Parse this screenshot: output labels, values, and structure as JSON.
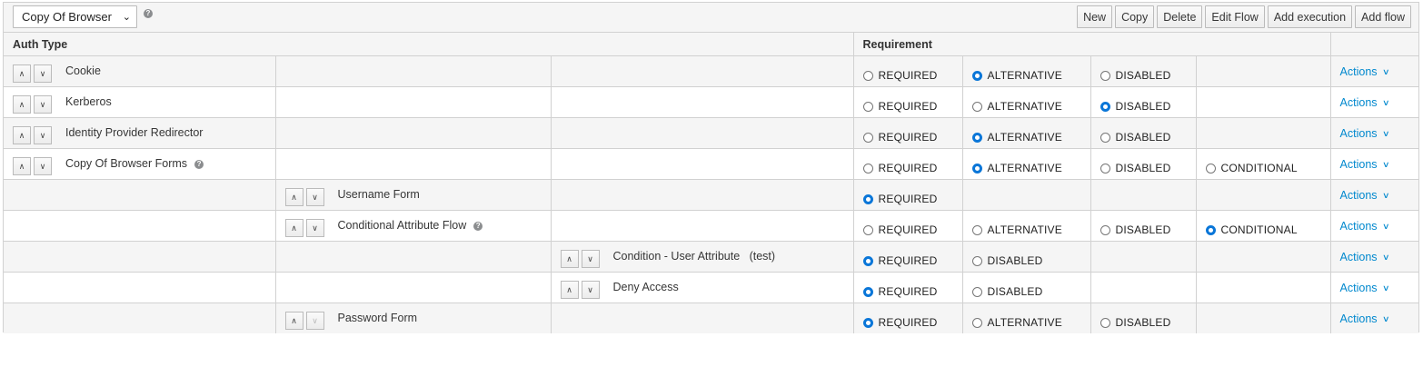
{
  "toolbar": {
    "flow_select": "Copy Of Browser",
    "buttons": [
      "New",
      "Copy",
      "Delete",
      "Edit Flow",
      "Add execution",
      "Add flow"
    ]
  },
  "table": {
    "headers": {
      "auth_type": "Auth Type",
      "requirement": "Requirement"
    },
    "rows": [
      {
        "name": "Cookie",
        "level": 0,
        "help": false,
        "down_enabled": true,
        "options": [
          {
            "label": "REQUIRED",
            "checked": false
          },
          {
            "label": "ALTERNATIVE",
            "checked": true
          },
          {
            "label": "DISABLED",
            "checked": false
          }
        ],
        "actions": "Actions"
      },
      {
        "name": "Kerberos",
        "level": 0,
        "help": false,
        "down_enabled": true,
        "options": [
          {
            "label": "REQUIRED",
            "checked": false
          },
          {
            "label": "ALTERNATIVE",
            "checked": false
          },
          {
            "label": "DISABLED",
            "checked": true
          }
        ],
        "actions": "Actions"
      },
      {
        "name": "Identity Provider Redirector",
        "level": 0,
        "help": false,
        "down_enabled": true,
        "options": [
          {
            "label": "REQUIRED",
            "checked": false
          },
          {
            "label": "ALTERNATIVE",
            "checked": true
          },
          {
            "label": "DISABLED",
            "checked": false
          }
        ],
        "actions": "Actions"
      },
      {
        "name": "Copy Of Browser Forms",
        "level": 0,
        "help": true,
        "down_enabled": true,
        "options": [
          {
            "label": "REQUIRED",
            "checked": false
          },
          {
            "label": "ALTERNATIVE",
            "checked": true
          },
          {
            "label": "DISABLED",
            "checked": false
          },
          {
            "label": "CONDITIONAL",
            "checked": false
          }
        ],
        "actions": "Actions"
      },
      {
        "name": "Username Form",
        "level": 1,
        "help": false,
        "down_enabled": true,
        "options": [
          {
            "label": "REQUIRED",
            "checked": true
          }
        ],
        "actions": "Actions"
      },
      {
        "name": "Conditional Attribute Flow",
        "level": 1,
        "help": true,
        "down_enabled": true,
        "options": [
          {
            "label": "REQUIRED",
            "checked": false
          },
          {
            "label": "ALTERNATIVE",
            "checked": false
          },
          {
            "label": "DISABLED",
            "checked": false
          },
          {
            "label": "CONDITIONAL",
            "checked": true
          }
        ],
        "actions": "Actions"
      },
      {
        "name": "Condition - User Attribute   (test)",
        "level": 2,
        "help": false,
        "down_enabled": true,
        "options": [
          {
            "label": "REQUIRED",
            "checked": true
          },
          {
            "label": "DISABLED",
            "checked": false
          }
        ],
        "actions": "Actions"
      },
      {
        "name": "Deny Access",
        "level": 2,
        "help": false,
        "down_enabled": true,
        "options": [
          {
            "label": "REQUIRED",
            "checked": true
          },
          {
            "label": "DISABLED",
            "checked": false
          }
        ],
        "actions": "Actions"
      },
      {
        "name": "Password Form",
        "level": 1,
        "help": false,
        "down_enabled": false,
        "options": [
          {
            "label": "REQUIRED",
            "checked": true
          },
          {
            "label": "ALTERNATIVE",
            "checked": false
          },
          {
            "label": "DISABLED",
            "checked": false
          }
        ],
        "actions": "Actions"
      }
    ]
  },
  "colors": {
    "link": "#0088ce",
    "radio_checked": "#0a76d8",
    "stripe": "#f5f5f5",
    "border": "#d1d1d1"
  }
}
